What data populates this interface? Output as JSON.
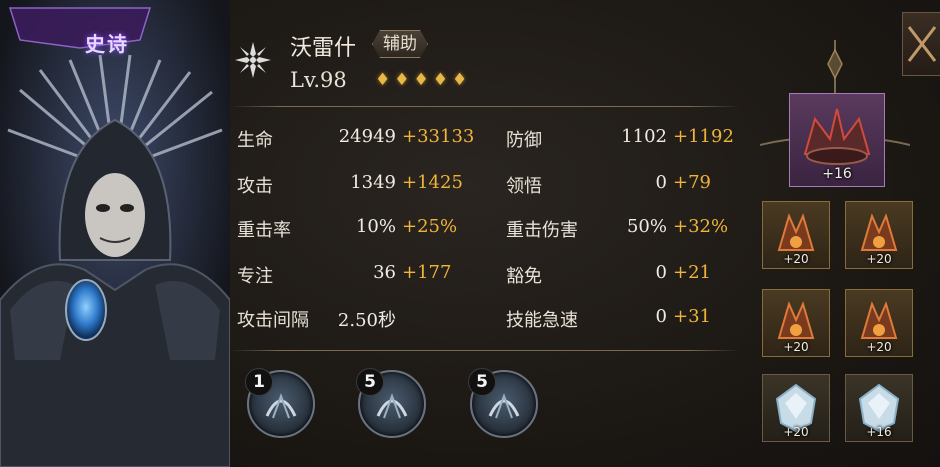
{
  "hero": {
    "rarity": "史诗",
    "name": "沃雷什",
    "role": "辅助",
    "level": "Lv.98",
    "stars": 5
  },
  "stats": {
    "rows": [
      {
        "left": {
          "label": "生命",
          "base": "24949",
          "bonus": "+33133"
        },
        "right": {
          "label": "防御",
          "base": "1102",
          "bonus": "+1192"
        }
      },
      {
        "left": {
          "label": "攻击",
          "base": "1349",
          "bonus": "+1425"
        },
        "right": {
          "label": "领悟",
          "base": "0",
          "bonus": "+79"
        }
      },
      {
        "left": {
          "label": "重击率",
          "base": "10%",
          "bonus": "+25%"
        },
        "right": {
          "label": "重击伤害",
          "base": "50%",
          "bonus": "+32%"
        }
      },
      {
        "left": {
          "label": "专注",
          "base": "36",
          "bonus": "+177"
        },
        "right": {
          "label": "豁免",
          "base": "0",
          "bonus": "+21"
        }
      },
      {
        "left": {
          "label": "攻击间隔",
          "base": "2.50秒",
          "bonus": ""
        },
        "right": {
          "label": "技能急速",
          "base": "0",
          "bonus": "+31"
        }
      }
    ]
  },
  "skills": [
    {
      "level": "1",
      "icon": "helm-skill-icon"
    },
    {
      "level": "5",
      "icon": "claw-skill-icon"
    },
    {
      "level": "5",
      "icon": "bird-skill-icon"
    }
  ],
  "equipment": {
    "main": {
      "value": "+16",
      "icon": "crown-icon"
    },
    "slots": [
      {
        "value": "+20",
        "icon": "helmet-icon"
      },
      {
        "value": "+20",
        "icon": "weapon-icon"
      },
      {
        "value": "+20",
        "icon": "armor-icon"
      },
      {
        "value": "+20",
        "icon": "gauntlet-icon"
      },
      {
        "value": "+20",
        "icon": "gem-icon"
      },
      {
        "value": "+16",
        "icon": "gem-icon"
      }
    ]
  },
  "colors": {
    "bonus": "#f0b43a",
    "rarity": "#8a4cff",
    "star": "#e6b84a"
  }
}
